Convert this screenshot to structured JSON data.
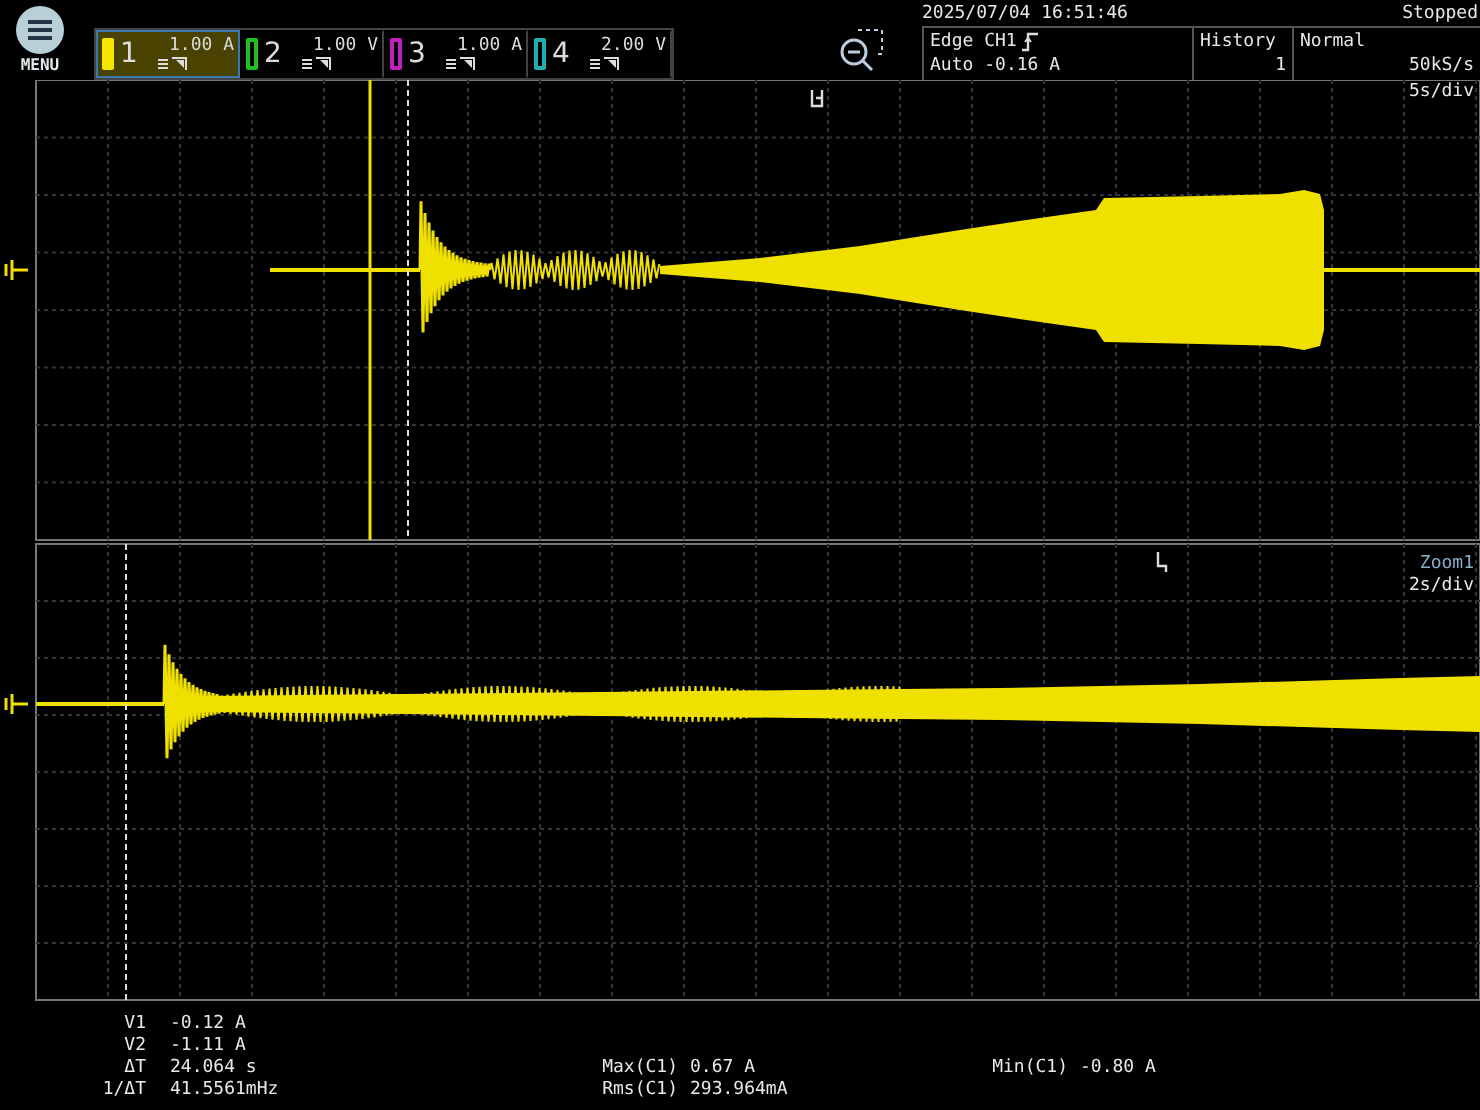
{
  "menu": {
    "label": "MENU"
  },
  "channels": [
    {
      "number": "1",
      "scale": "1.00 A",
      "selected": true,
      "color": "#f5e600"
    },
    {
      "number": "2",
      "scale": "1.00 V",
      "selected": false,
      "color": "#1fbf1f"
    },
    {
      "number": "3",
      "scale": "1.00 A",
      "selected": false,
      "color": "#c020c0"
    },
    {
      "number": "4",
      "scale": "2.00 V",
      "selected": false,
      "color": "#20b0b0"
    }
  ],
  "timestamp": "2025/07/04 16:51:46",
  "status": "Stopped",
  "trigger": {
    "source": "Edge CH1",
    "mode": "Auto",
    "level": "-0.16 A"
  },
  "history": {
    "label": "History",
    "value": "1"
  },
  "acquisition": {
    "mode": "Normal",
    "rate": "50kS/s"
  },
  "main_view": {
    "timebase": "5s/div"
  },
  "zoom_view": {
    "label": "Zoom1",
    "timebase": "2s/div"
  },
  "cursors": [
    {
      "label": "V1",
      "value": "-0.12 A"
    },
    {
      "label": "V2",
      "value": "-1.11 A"
    },
    {
      "label": "ΔT",
      "value": "24.064 s"
    },
    {
      "label": "1/ΔT",
      "value": "41.5561mHz"
    }
  ],
  "measurements": [
    {
      "label": "Max(C1)",
      "value": "0.67 A"
    },
    {
      "label": "Rms(C1)",
      "value": "293.964mA"
    },
    {
      "label": "Min(C1)",
      "value": "-0.80 A"
    }
  ]
}
